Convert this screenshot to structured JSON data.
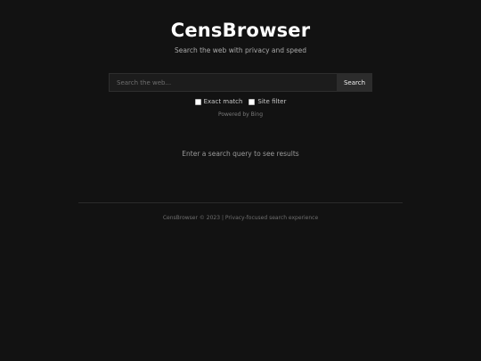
{
  "app": {
    "title": "CensBrowser",
    "tagline": "Search the web with privacy and speed"
  },
  "search": {
    "placeholder": "Search the web...",
    "value": "",
    "button_label": "Search"
  },
  "options": {
    "exact_match_label": "Exact match",
    "site_filter_label": "Site filter"
  },
  "powered_by": "Powered by Bing",
  "results": {
    "empty_message": "Enter a search query to see results"
  },
  "footer": {
    "text": "CensBrowser © 2023 | Privacy-focused search experience"
  }
}
